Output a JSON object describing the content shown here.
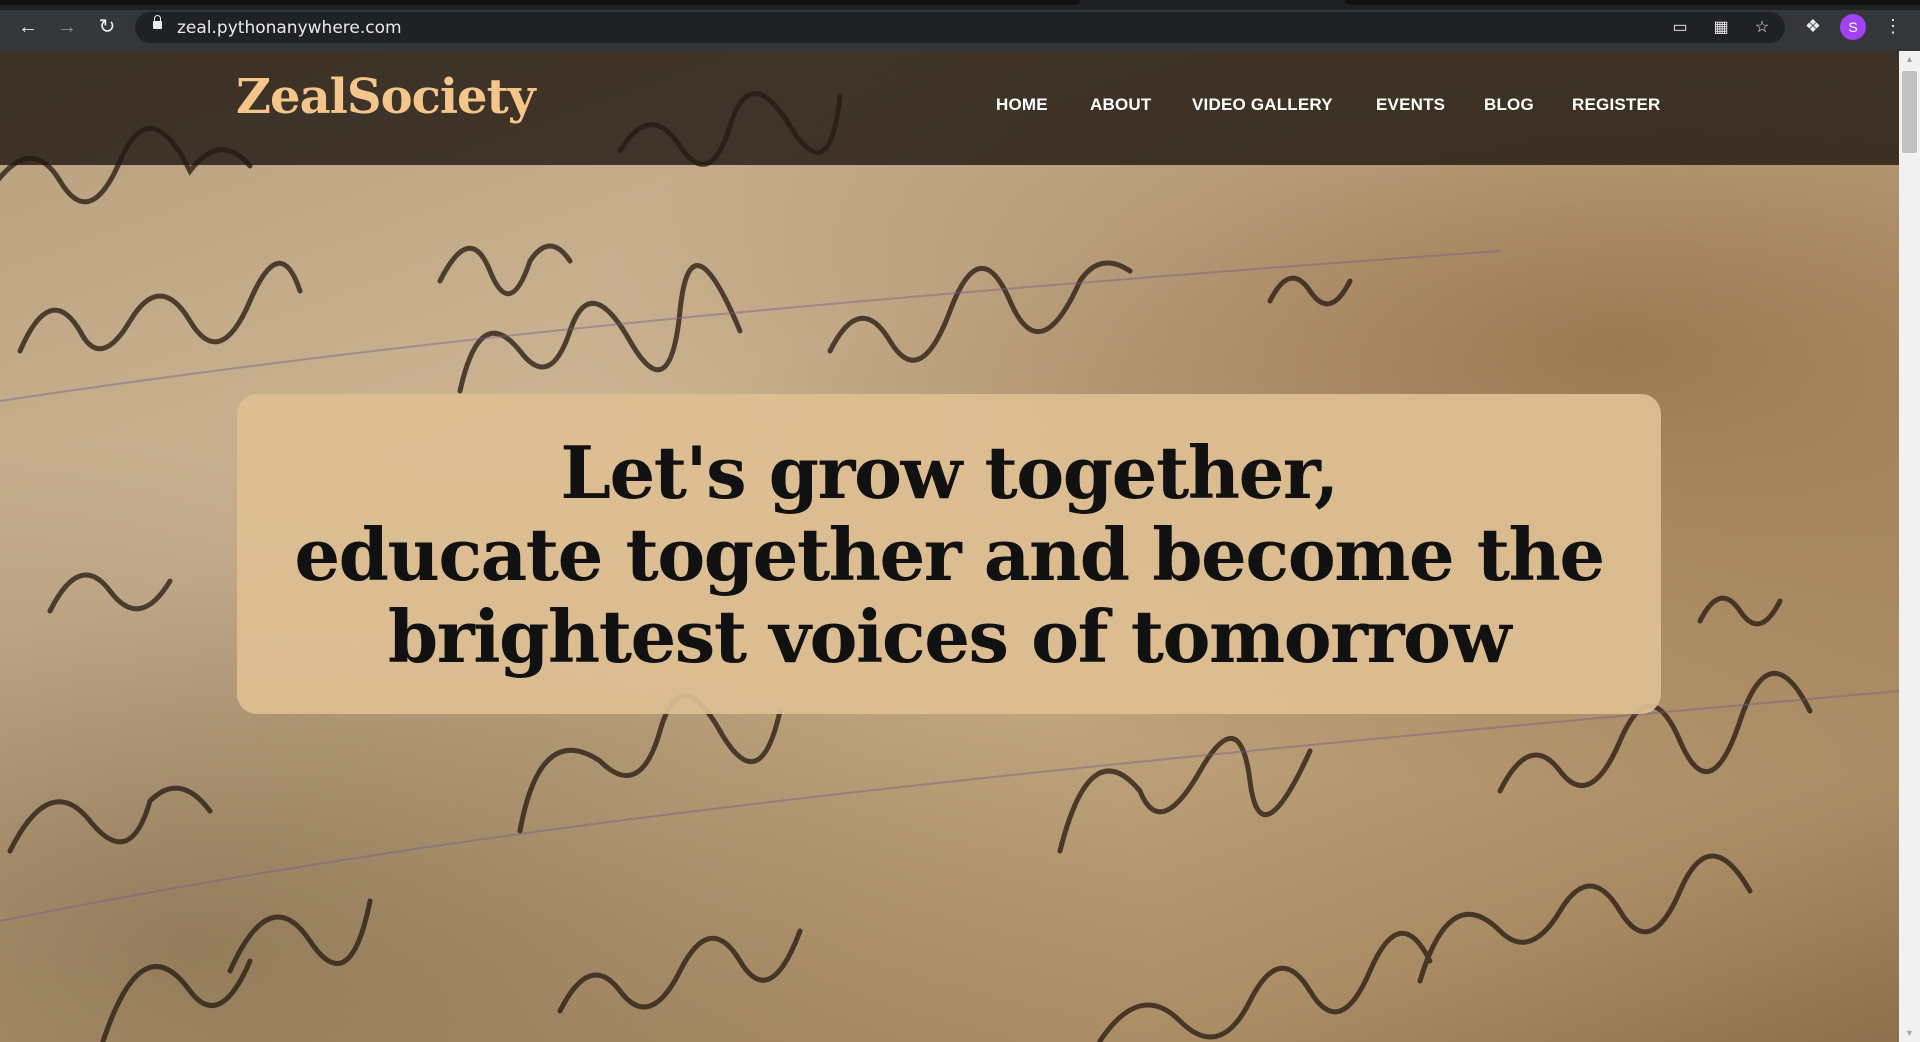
{
  "browser": {
    "url": "zeal.pythonanywhere.com",
    "profile_initial": "S",
    "icons": {
      "back": "arrow-left-icon",
      "forward": "arrow-right-icon",
      "reload": "reload-icon",
      "secure": "lock-icon",
      "cast": "cast-icon",
      "qr": "qr-code-icon",
      "bookmark": "star-icon",
      "extensions": "puzzle-icon",
      "menu": "more-vertical-icon"
    }
  },
  "site": {
    "logo": "ZealSociety",
    "nav": {
      "home": "HOME",
      "about": "ABOUT",
      "video_gallery": "VIDEO GALLERY",
      "events": "EVENTS",
      "blog": "BLOG",
      "register": "REGISTER"
    },
    "hero": {
      "line1": "Let's grow together,",
      "line2": "educate together and become the",
      "line3": "brightest voices of tomorrow"
    }
  },
  "colors": {
    "logo": "#f5c68b",
    "header_bg": "#221a14",
    "hero_box": "#debf94",
    "hero_text": "#111111",
    "chrome_bg": "#35363a",
    "omnibox_bg": "#202124"
  }
}
